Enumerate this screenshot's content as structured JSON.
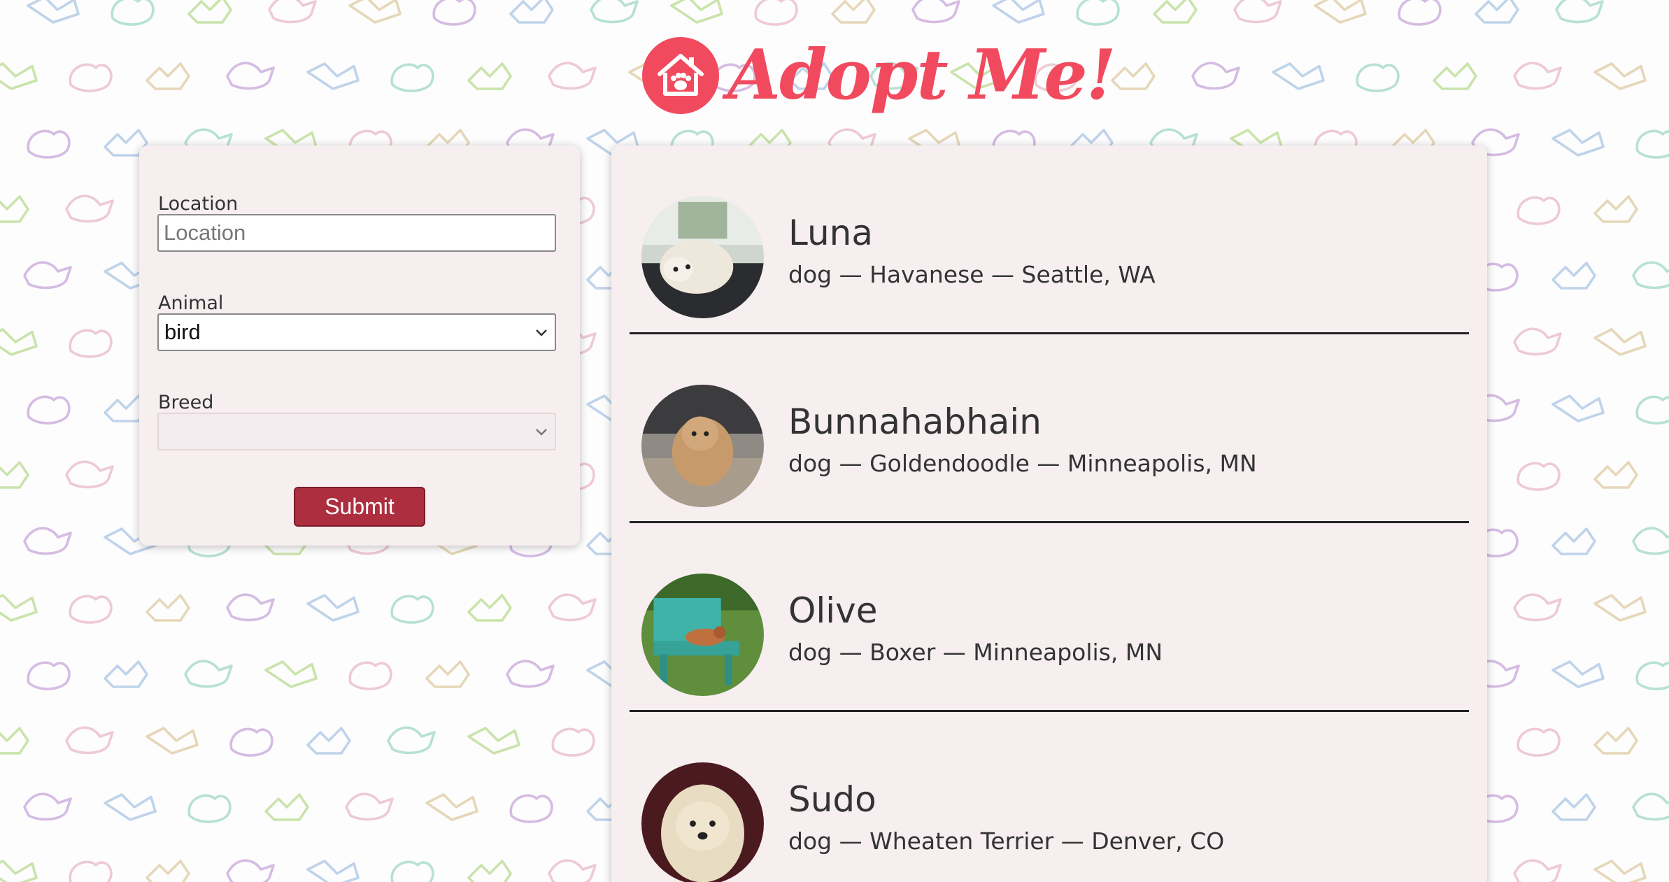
{
  "header": {
    "logo_text": "Adopt Me!"
  },
  "search_form": {
    "location": {
      "label": "Location",
      "placeholder": "Location",
      "value": ""
    },
    "animal": {
      "label": "Animal",
      "selected": "bird"
    },
    "breed": {
      "label": "Breed",
      "selected": ""
    },
    "submit_label": "Submit"
  },
  "pets": [
    {
      "name": "Luna",
      "description": "dog — Havanese — Seattle, WA"
    },
    {
      "name": "Bunnahabhain",
      "description": "dog — Goldendoodle — Minneapolis, MN"
    },
    {
      "name": "Olive",
      "description": "dog — Boxer — Minneapolis, MN"
    },
    {
      "name": "Sudo",
      "description": "dog — Wheaten Terrier — Denver, CO"
    }
  ],
  "colors": {
    "brand": "#f14a5f",
    "submit": "#ad2f3f",
    "panel": "#f7eef0"
  }
}
